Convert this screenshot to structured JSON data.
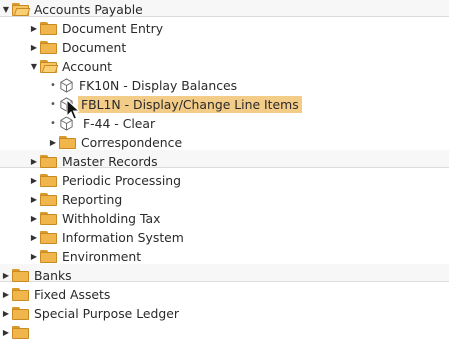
{
  "tree": {
    "accounts_payable": "Accounts Payable",
    "document_entry": "Document Entry",
    "document": "Document",
    "account": "Account",
    "fk10n": "FK10N - Display Balances",
    "fbl1n": "FBL1N - Display/Change Line Items",
    "f44": "F-44 - Clear",
    "correspondence": "Correspondence",
    "master_records": "Master Records",
    "periodic_processing": "Periodic Processing",
    "reporting": "Reporting",
    "withholding_tax": "Withholding Tax",
    "information_system": "Information System",
    "environment": "Environment",
    "banks": "Banks",
    "fixed_assets": "Fixed Assets",
    "special_purpose_ledger": "Special Purpose Ledger"
  },
  "colors": {
    "highlight": "#f3cc87",
    "folder": "#f0b64b"
  }
}
